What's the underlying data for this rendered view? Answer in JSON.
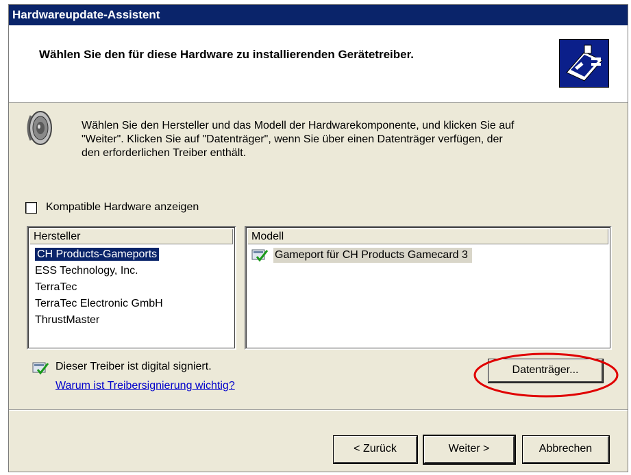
{
  "window": {
    "title": "Hardwareupdate-Assistent",
    "header_title": "Wählen Sie den für diese Hardware zu installierenden Gerätetreiber."
  },
  "info": {
    "line1": "Wählen Sie den Hersteller und das Modell der Hardwarekomponente, und klicken Sie auf",
    "line2": "\"Weiter\". Klicken Sie auf \"Datenträger\", wenn Sie über einen Datenträger verfügen, der",
    "line3": "den erforderlichen Treiber enthält."
  },
  "compat_checkbox": {
    "label": "Kompatible Hardware anzeigen",
    "checked": false
  },
  "manufacturers": {
    "header": "Hersteller",
    "items": [
      "CH Products-Gameports",
      "ESS Technology, Inc.",
      "TerraTec",
      "TerraTec Electronic GmbH",
      "ThrustMaster"
    ],
    "selected_index": 0
  },
  "models": {
    "header": "Modell",
    "items": [
      "Gameport für CH Products Gamecard 3"
    ]
  },
  "signature": {
    "text": "Dieser Treiber ist digital signiert.",
    "link": "Warum ist Treibersignierung wichtig?"
  },
  "buttons": {
    "disk": "Datenträger...",
    "back": "< Zurück",
    "next": "Weiter >",
    "cancel": "Abbrechen"
  },
  "colors": {
    "title_bar": "#0A246A",
    "dialog_bg": "#ECE9D8",
    "highlight_ellipse": "#E00000",
    "link": "#0000CC"
  }
}
